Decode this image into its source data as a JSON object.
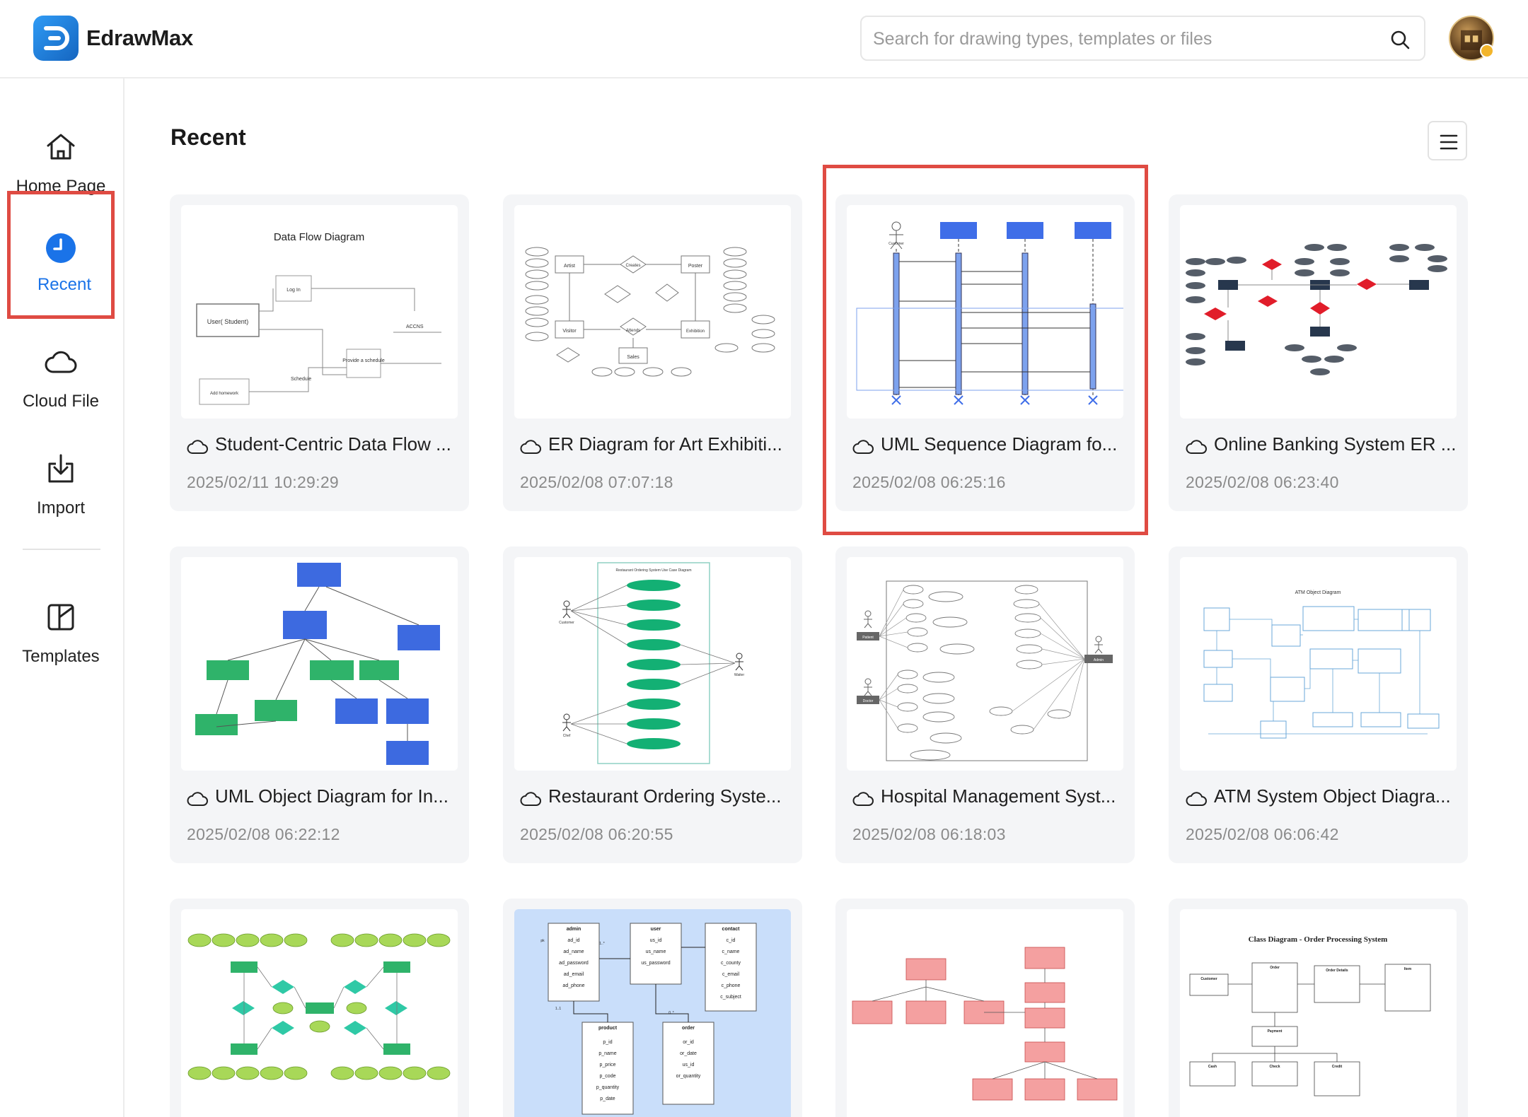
{
  "app": {
    "brand": "EdrawMax"
  },
  "search": {
    "placeholder": "Search for drawing types, templates or files"
  },
  "sidebar": {
    "items": [
      {
        "label": "Home Page",
        "icon": "home-icon"
      },
      {
        "label": "Recent",
        "icon": "clock-icon",
        "active": true
      },
      {
        "label": "Cloud File",
        "icon": "cloud-icon"
      },
      {
        "label": "Import",
        "icon": "import-icon"
      },
      {
        "label": "Templates",
        "icon": "templates-icon"
      }
    ]
  },
  "main": {
    "title": "Recent",
    "cards": [
      {
        "title": "Student-Centric Data Flow ...",
        "date": "2025/02/11 10:29:29",
        "thumb_text": [
          "Data Flow Diagram",
          "User( Student)",
          "Log In",
          "Provide a schedule",
          "Schedule",
          "Add homework",
          "ACCNS"
        ]
      },
      {
        "title": "ER Diagram for Art Exhibiti...",
        "date": "2025/02/08 07:07:18",
        "thumb_text": [
          "Artist",
          "Creates",
          "Poster",
          "Visitor",
          "Attends",
          "Exhibition",
          "Sales"
        ]
      },
      {
        "title": "UML Sequence Diagram fo...",
        "date": "2025/02/08 06:25:16",
        "highlighted": true,
        "thumb_text": [
          "Customer"
        ]
      },
      {
        "title": "Online Banking System ER ...",
        "date": "2025/02/08 06:23:40"
      },
      {
        "title": "UML Object Diagram for In...",
        "date": "2025/02/08 06:22:12"
      },
      {
        "title": "Restaurant Ordering Syste...",
        "date": "2025/02/08 06:20:55",
        "thumb_text": [
          "Restaurant Ordering System Use Case Diagram",
          "Customer",
          "Waiter",
          "Chef"
        ]
      },
      {
        "title": "Hospital Management Syst...",
        "date": "2025/02/08 06:18:03",
        "thumb_text": [
          "Patient",
          "Doctor",
          "Admin"
        ]
      },
      {
        "title": "ATM System Object Diagra...",
        "date": "2025/02/08 06:06:42",
        "thumb_text": [
          "ATM Object Diagram"
        ]
      },
      {
        "title": "",
        "date": ""
      },
      {
        "title": "",
        "date": "",
        "thumb_text": [
          "admin",
          "ad_id",
          "ad_name",
          "ad_password",
          "ad_email",
          "ad_phone",
          "user",
          "us_id",
          "us_name",
          "us_password",
          "contact",
          "c_id",
          "c_name",
          "c_county",
          "c_email",
          "c_phone",
          "c_subject",
          "product",
          "p_id",
          "p_name",
          "p_price",
          "p_code",
          "p_quantity",
          "p_date",
          "order",
          "or_id",
          "or_date",
          "us_id",
          "or_quantity",
          "pk",
          "1..1",
          "1..*",
          "0..*"
        ]
      },
      {
        "title": "",
        "date": ""
      },
      {
        "title": "",
        "date": "",
        "thumb_text": [
          "Class Diagram - Order Processing System",
          "Customer",
          "Order",
          "Order Details",
          "Item",
          "Payment",
          "Cash",
          "Check",
          "Credit"
        ]
      }
    ]
  },
  "colors": {
    "accent": "#1a73e8",
    "highlight": "#df4b43",
    "brand_logo": "#1e88e5"
  }
}
